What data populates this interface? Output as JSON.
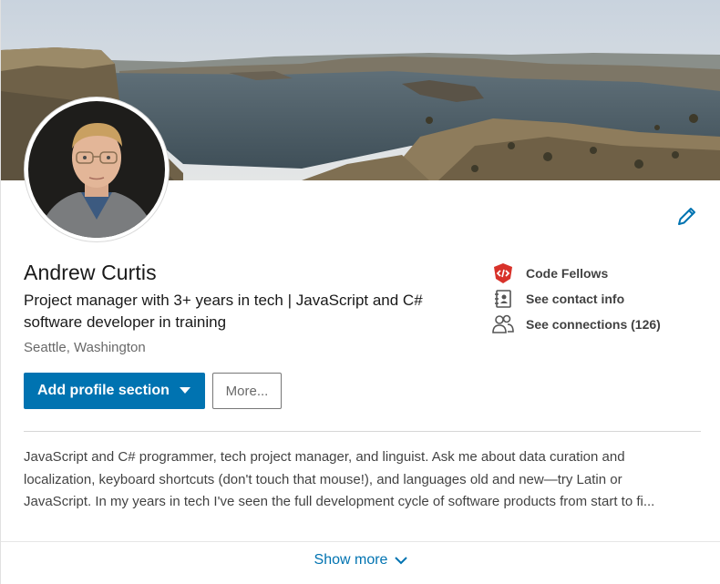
{
  "profile": {
    "name": "Andrew Curtis",
    "headline": "Project manager with 3+ years in tech | JavaScript and C# software developer in training",
    "location": "Seattle, Washington"
  },
  "sidebar": {
    "items": [
      {
        "label": "Code Fellows",
        "icon": "code-fellows-logo"
      },
      {
        "label": "See contact info",
        "icon": "contact-card-icon"
      },
      {
        "label": "See connections (126)",
        "icon": "people-icon"
      }
    ]
  },
  "actions": {
    "add_section_label": "Add profile section",
    "more_label": "More..."
  },
  "summary": {
    "lines": [
      "JavaScript and C# programmer, tech project manager, and linguist. Ask me about data curation and",
      "localization, keyboard shortcuts (don't touch that mouse!), and languages old and new—try Latin or",
      "JavaScript. In my years in tech I've seen the full development cycle of software products from start to fi..."
    ]
  },
  "footer": {
    "show_more_label": "Show more"
  },
  "colors": {
    "primary": "#0073b1",
    "code_fellows_red": "#d8322a"
  }
}
